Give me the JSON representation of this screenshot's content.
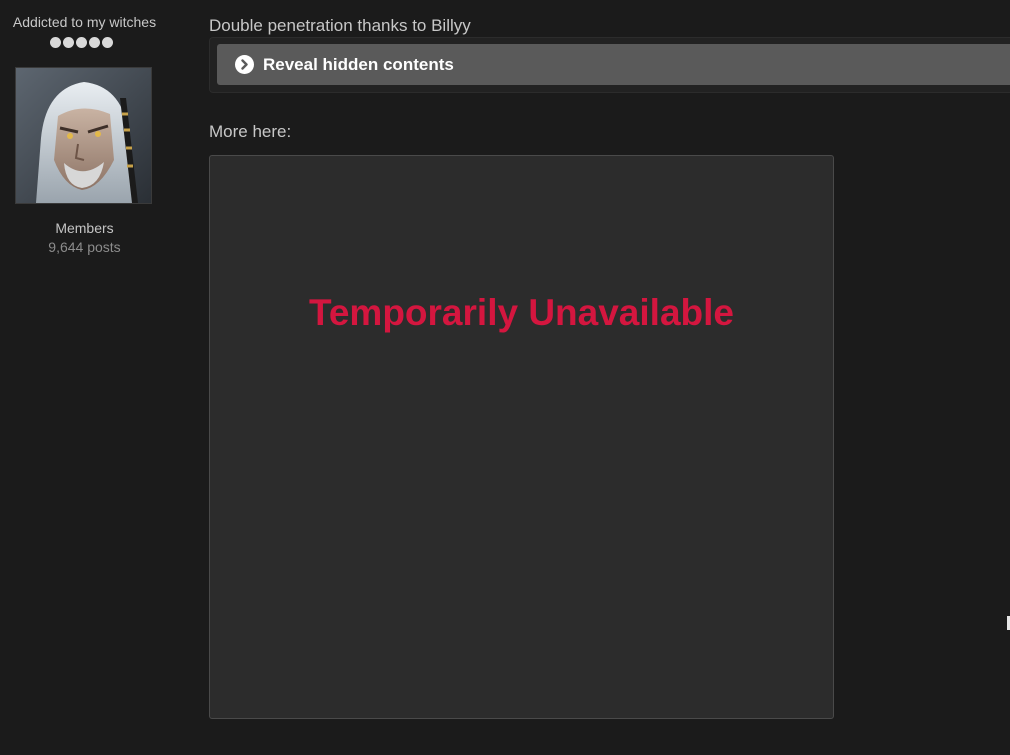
{
  "author": {
    "title": "Addicted to my witches",
    "rank_pips": 5,
    "avatar_icon": "avatar-witcher-portrait",
    "group": "Members",
    "post_count": "9,644 posts"
  },
  "post": {
    "text": "Double penetration thanks to Billyy",
    "hidden_content": {
      "button_label": "Reveal hidden contents",
      "icon": "chevron-right-circle-icon"
    },
    "more_label": "More here:",
    "embed": {
      "message": "Temporarily Unavailable"
    }
  },
  "colors": {
    "background": "#1b1b1b",
    "reveal_button": "#5a5a5a",
    "embed_background": "#2c2c2c",
    "unavailable_text": "#d4163f"
  }
}
